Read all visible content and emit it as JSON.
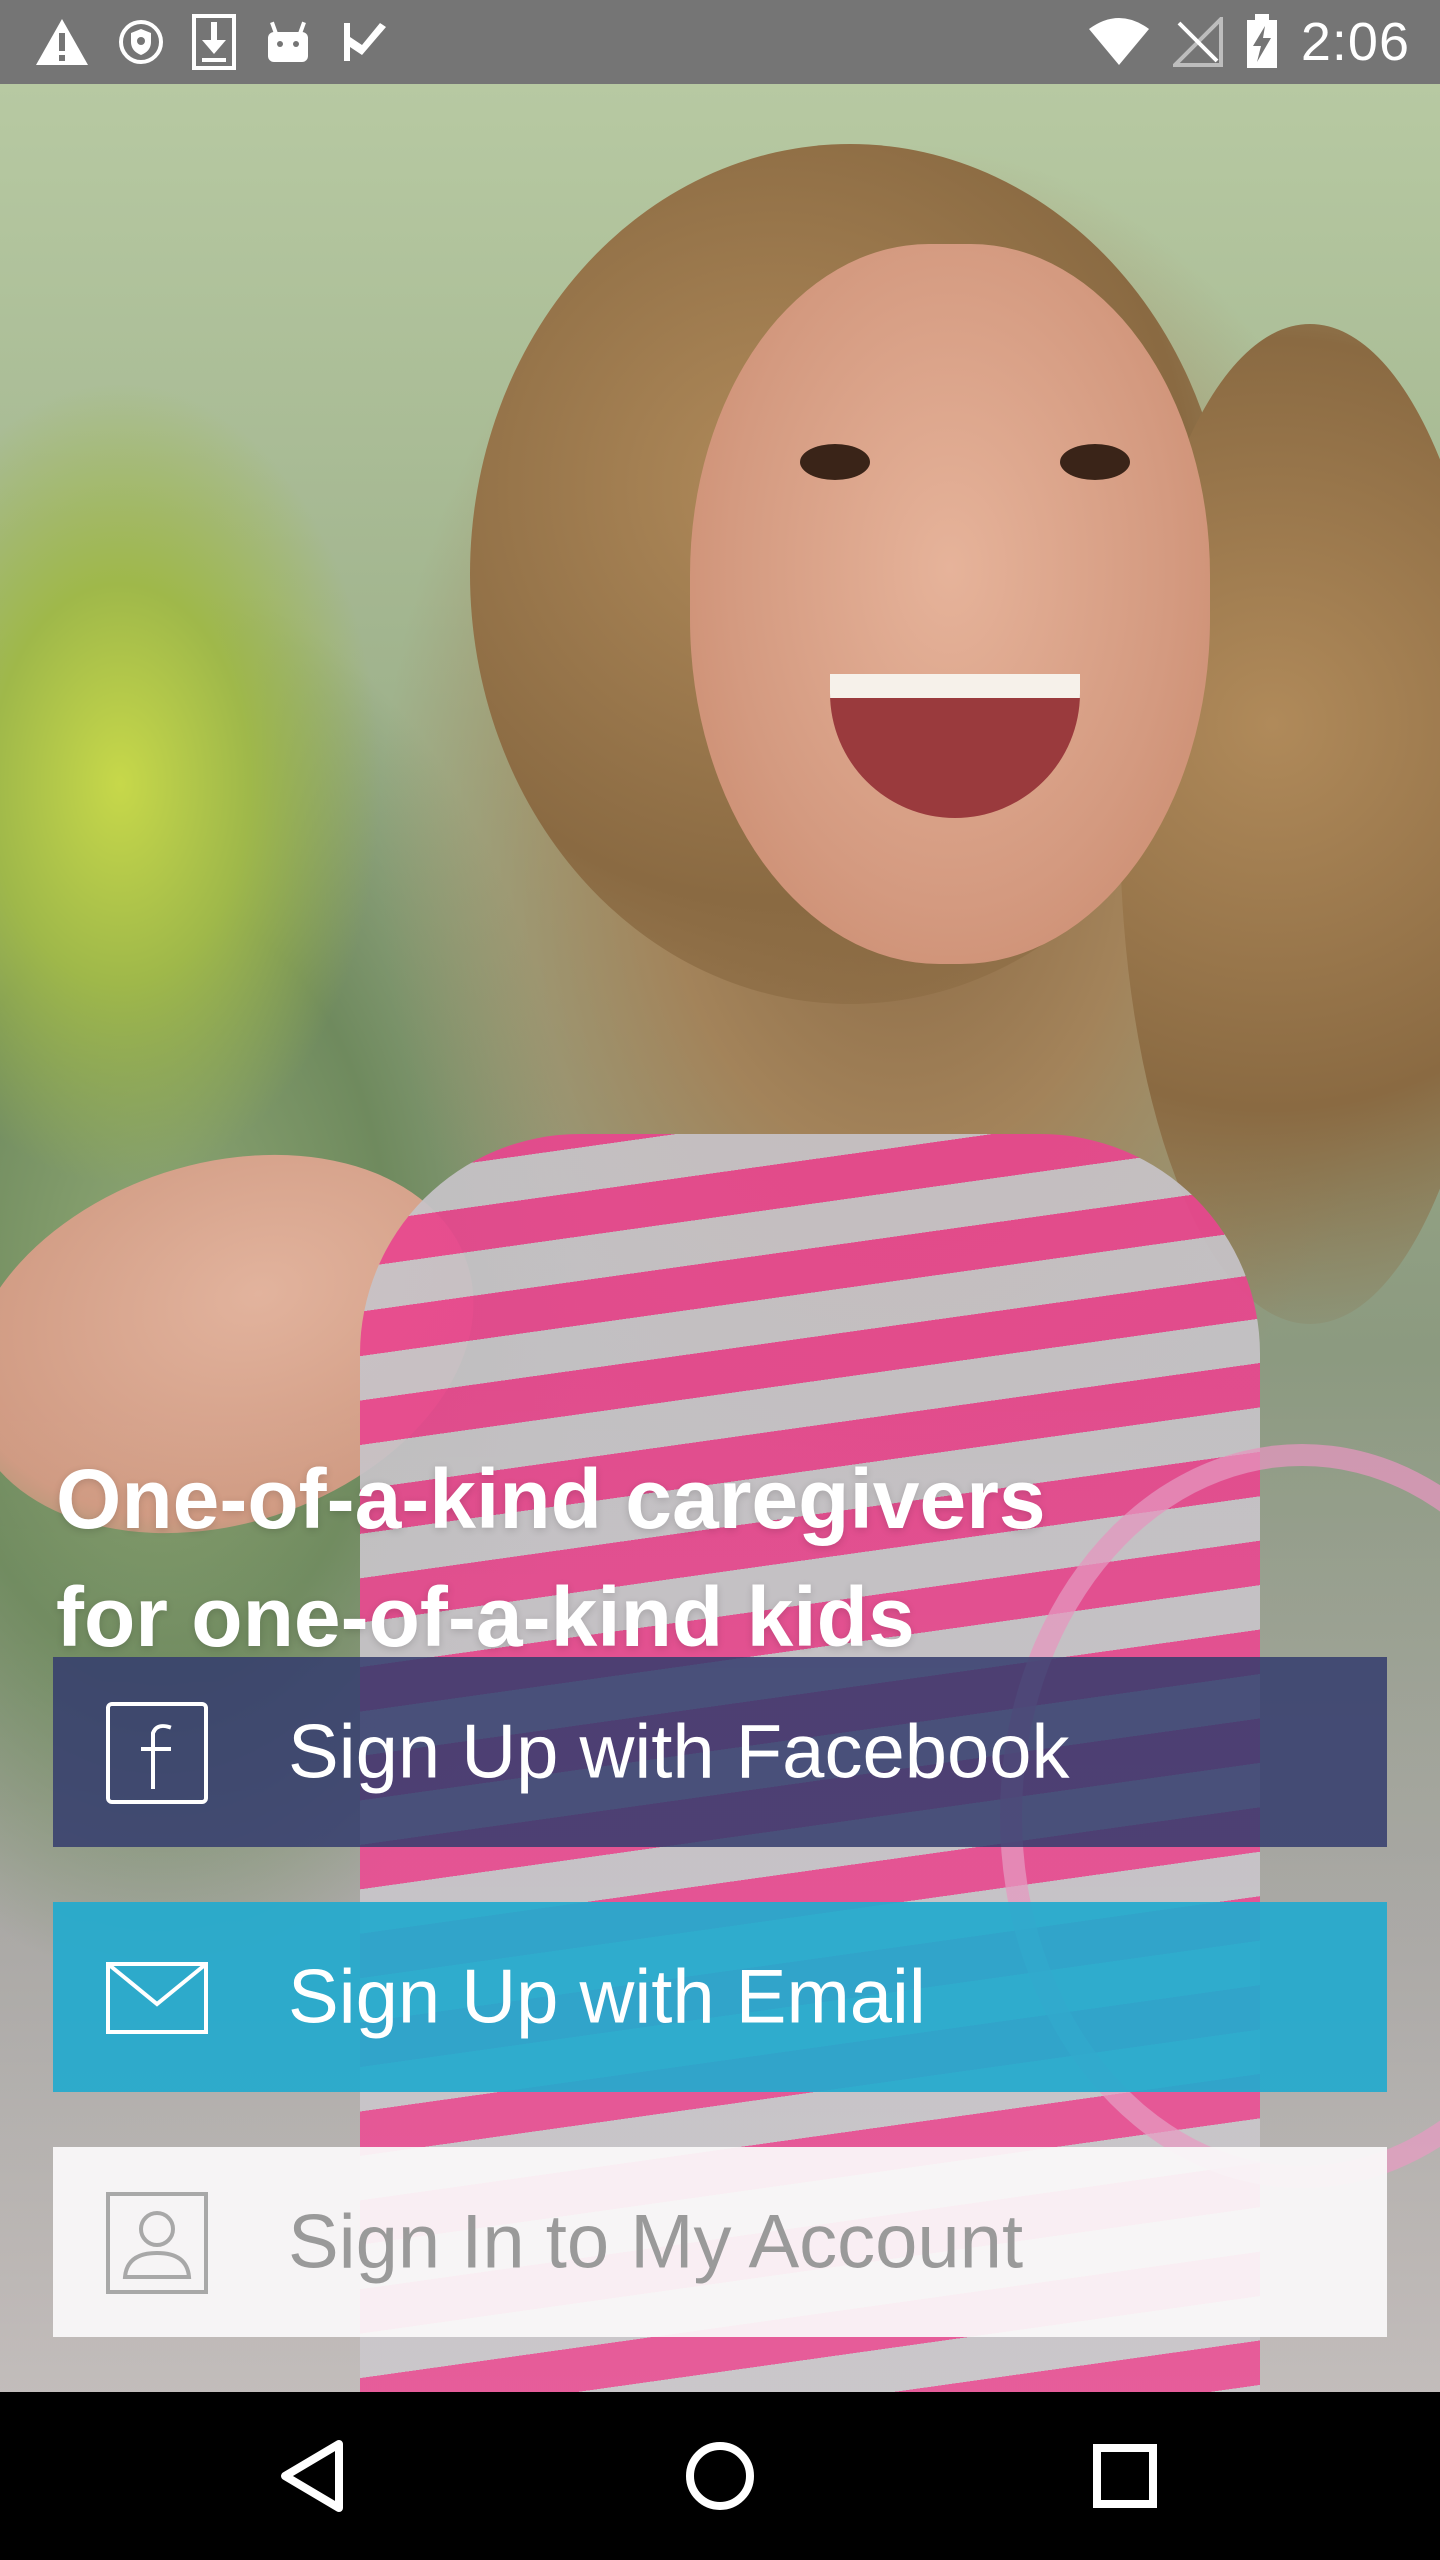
{
  "status_bar": {
    "time": "2:06",
    "left_icons": [
      "warning-icon",
      "shield-icon",
      "download-icon",
      "android-icon",
      "check-flag-icon"
    ],
    "right_icons": [
      "wifi-icon",
      "no-signal-icon",
      "battery-charging-icon"
    ],
    "background": "#757575"
  },
  "hero": {
    "headline_line1": "One-of-a-kind caregivers",
    "headline_line2": "for one-of-a-kind kids"
  },
  "buttons": {
    "facebook": {
      "label": "Sign Up with Facebook",
      "icon": "facebook-icon",
      "color": "#343C6E"
    },
    "email": {
      "label": "Sign Up with Email",
      "icon": "envelope-icon",
      "color": "#24AACD"
    },
    "signin": {
      "label": "Sign In to My Account",
      "icon": "user-icon",
      "color": "#FAF8F9"
    }
  },
  "nav_bar": {
    "icons": [
      "back-icon",
      "home-icon",
      "recents-icon"
    ]
  }
}
